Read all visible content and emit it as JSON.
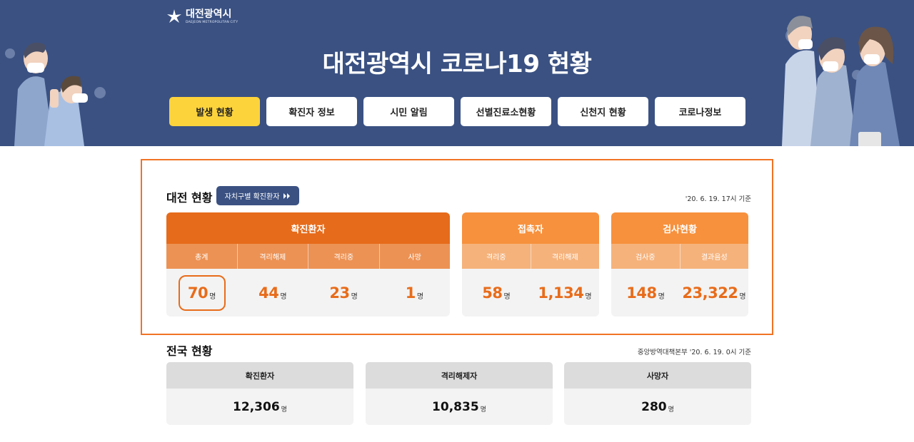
{
  "header": {
    "logo_main": "대전광역시",
    "logo_sub": "DAEJEON METROPOLITAN CITY",
    "title": "대전광역시 코로나19 현황",
    "bg_color": "#3a5182"
  },
  "nav": {
    "items": [
      {
        "label": "발생 현황",
        "active": true
      },
      {
        "label": "확진자 정보",
        "active": false
      },
      {
        "label": "시민 알림",
        "active": false
      },
      {
        "label": "선별진료소현황",
        "active": false
      },
      {
        "label": "신천지 현황",
        "active": false
      },
      {
        "label": "코로나정보",
        "active": false
      }
    ]
  },
  "daejeon": {
    "title": "대전 현황",
    "region_button": "자치구별 확진환자",
    "region_button_icon": "double-chevron-right-icon",
    "timestamp": "'20. 6. 19. 17시 기준",
    "confirmed": {
      "header": "확진환자",
      "color": "#e66b1a",
      "sub_color": "#ec9254",
      "columns": [
        "총계",
        "격리해제",
        "격리중",
        "사망"
      ],
      "values": [
        "70",
        "44",
        "23",
        "1"
      ],
      "unit": "명"
    },
    "contacts": {
      "header": "접촉자",
      "color": "#f7913d",
      "sub_color": "#f5b27b",
      "columns": [
        "격리중",
        "격리해제"
      ],
      "values": [
        "58",
        "1,134"
      ],
      "unit": "명"
    },
    "tests": {
      "header": "검사현황",
      "color": "#f7913d",
      "sub_color": "#f5b27b",
      "columns": [
        "검사중",
        "결과음성"
      ],
      "values": [
        "148",
        "23,322"
      ],
      "unit": "명"
    }
  },
  "national": {
    "title": "전국 현황",
    "timestamp": "중앙방역대책본부 '20. 6. 19. 0시 기준",
    "cards": [
      {
        "label": "확진환자",
        "value": "12,306",
        "unit": "명"
      },
      {
        "label": "격리해제자",
        "value": "10,835",
        "unit": "명"
      },
      {
        "label": "사망자",
        "value": "280",
        "unit": "명"
      }
    ]
  }
}
